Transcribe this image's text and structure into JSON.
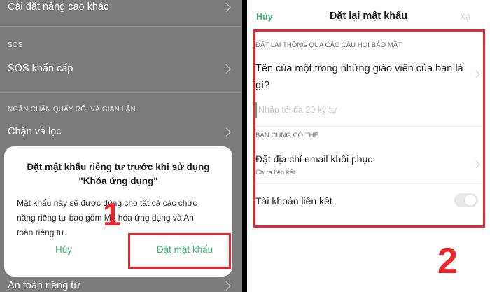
{
  "left": {
    "rows": [
      {
        "label": "Cài đặt nâng cao khác"
      },
      {
        "label": "SOS khẩn cấp"
      },
      {
        "label": "Chặn và lọc"
      },
      {
        "label": "An toàn riêng tư"
      }
    ],
    "sections": [
      "SOS",
      "NGĂN CHẶN QUẤY RỐI VÀ GIAN LẬN"
    ],
    "dialog": {
      "title_line1": "Đặt mật khẩu riêng tư trước khi sử dụng",
      "title_line2": "\"Khóa ứng dụng\"",
      "body_line1": "Mật khẩu này sẽ được dùng cho tất cả các chức",
      "body_line2": "năng riêng tư bao gồm Mã hóa ứng dụng và An",
      "body_line3": "toàn riêng tư.",
      "cancel_label": "Hủy",
      "confirm_label": "Đặt mật khẩu"
    },
    "step_number": "1"
  },
  "right": {
    "header": {
      "cancel_label": "Hủy",
      "title": "Đặt lại mật khẩu",
      "confirm_label": "Xá"
    },
    "section_security": "ĐẶT LẠI THÔNG QUA CÁC CÂU HỎI BẢO MẬT",
    "question_line1": "Tên của một trong những giáo viên của bạn là",
    "question_line2": "gì?",
    "answer_placeholder": "Nhập tối đa 20 ký tự",
    "section_also": "BẠN CŨNG CÓ THỂ",
    "email_option": {
      "label": "Đặt địa chỉ email khôi phục",
      "sub": "Chưa liên kết"
    },
    "linked_account": {
      "label": "Tài khoản liên kết",
      "enabled": false
    },
    "step_number": "2"
  },
  "colors": {
    "accent_green": "#3bb37a",
    "annotation_red": "#e8262d",
    "overlay_gray": "#7b7b7b"
  }
}
